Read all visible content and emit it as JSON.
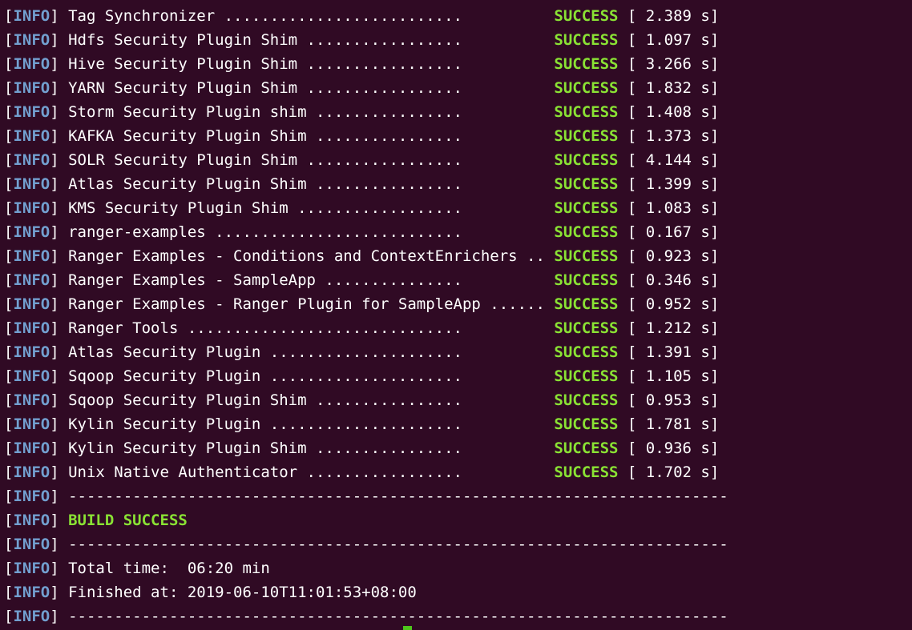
{
  "terminal": {
    "level": "INFO",
    "status": "SUCCESS",
    "cursor_color": "#4ec51b",
    "colors": {
      "background": "#300a24",
      "text": "#ffffff",
      "info": "#729fcf",
      "success": "#8ae234"
    },
    "results": [
      {
        "dots": "Tag Synchronizer ..........................",
        "time": " 2.389 s]"
      },
      {
        "dots": "Hdfs Security Plugin Shim .................",
        "time": " 1.097 s]"
      },
      {
        "dots": "Hive Security Plugin Shim .................",
        "time": " 3.266 s]"
      },
      {
        "dots": "YARN Security Plugin Shim .................",
        "time": " 1.832 s]"
      },
      {
        "dots": "Storm Security Plugin shim ................",
        "time": " 1.408 s]"
      },
      {
        "dots": "KAFKA Security Plugin Shim ................",
        "time": " 1.373 s]"
      },
      {
        "dots": "SOLR Security Plugin Shim .................",
        "time": " 4.144 s]"
      },
      {
        "dots": "Atlas Security Plugin Shim ................",
        "time": " 1.399 s]"
      },
      {
        "dots": "KMS Security Plugin Shim ..................",
        "time": " 1.083 s]"
      },
      {
        "dots": "ranger-examples ...........................",
        "time": " 0.167 s]"
      },
      {
        "dots": "Ranger Examples - Conditions and ContextEnrichers ..",
        "time": " 0.923 s]"
      },
      {
        "dots": "Ranger Examples - SampleApp ...............",
        "time": " 0.346 s]"
      },
      {
        "dots": "Ranger Examples - Ranger Plugin for SampleApp ......",
        "time": " 0.952 s]"
      },
      {
        "dots": "Ranger Tools ..............................",
        "time": " 1.212 s]"
      },
      {
        "dots": "Atlas Security Plugin .....................",
        "time": " 1.391 s]"
      },
      {
        "dots": "Sqoop Security Plugin .....................",
        "time": " 1.105 s]"
      },
      {
        "dots": "Sqoop Security Plugin Shim ................",
        "time": " 0.953 s]"
      },
      {
        "dots": "Kylin Security Plugin .....................",
        "time": " 1.781 s]"
      },
      {
        "dots": "Kylin Security Plugin Shim ................",
        "time": " 0.936 s]"
      },
      {
        "dots": "Unix Native Authenticator .................",
        "time": " 1.702 s]"
      }
    ],
    "separator": "------------------------------------------------------------------------",
    "build_result": "BUILD SUCCESS",
    "total_time": "Total time:  06:20 min",
    "finished_at": "Finished at: 2019-06-10T11:01:53+08:00"
  }
}
